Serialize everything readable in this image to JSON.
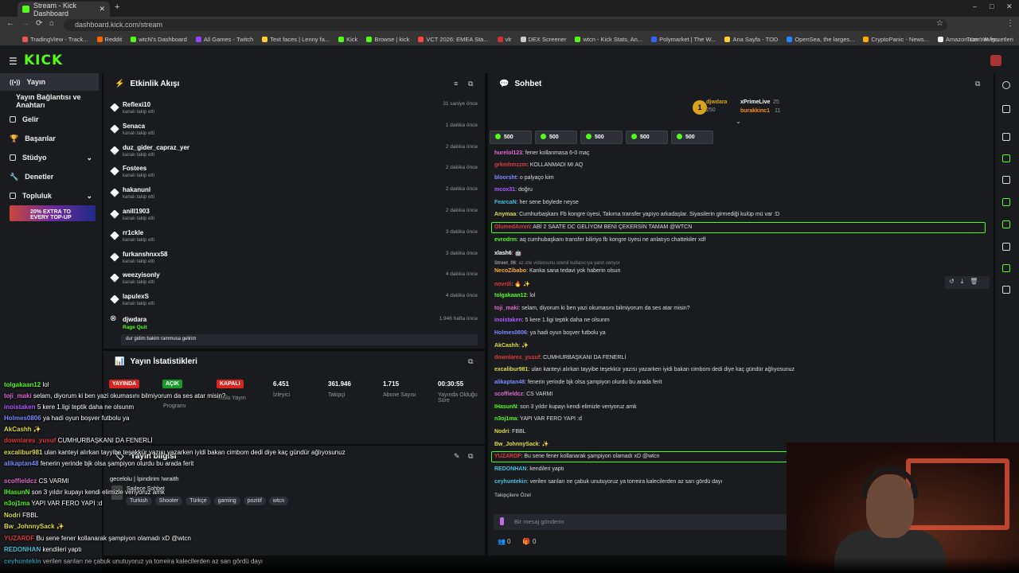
{
  "browser": {
    "tab_title": "Stream - Kick Dashboard",
    "url": "dashboard.kick.com/stream",
    "bookmarks": [
      "TradingView - Track...",
      "Reddit",
      "wtcN's Dashboard",
      "All Games - Twitch",
      "Text faces | Lenny fa...",
      "Kick",
      "Browse | kick",
      "VCT 2026: EMEA Sta...",
      "vlr",
      "DEX Screener",
      "wtcn - Kick Stats, An...",
      "Polymarket | The W...",
      "Ana Sayfa - TOD",
      "OpenSea, the larges...",
      "CryptoPanic - News...",
      "Amazon.com: AVer..."
    ],
    "all_bookmarks": "Tüm Yer İşaretleri"
  },
  "logo": "KICK",
  "sidebar": {
    "items": [
      {
        "label": "Yayın"
      },
      {
        "label": "Yayın Bağlantısı ve Anahtarı"
      },
      {
        "label": "Gelir"
      },
      {
        "label": "Başarılar"
      },
      {
        "label": "Stüdyo"
      },
      {
        "label": "Denetler"
      },
      {
        "label": "Topluluk"
      }
    ],
    "banner": "20% EXTRA TO EVERY TOP-UP"
  },
  "activity": {
    "title": "Etkinlik Akışı",
    "rows": [
      {
        "name": "Reflexi10",
        "sub": "kanalı takip etti",
        "time": "31 saniye önce"
      },
      {
        "name": "Senaca",
        "sub": "kanalı takip etti",
        "time": "1 dakika önce"
      },
      {
        "name": "duz_gider_capraz_yer",
        "sub": "kanalı takip etti",
        "time": "2 dakika önce"
      },
      {
        "name": "Fostees",
        "sub": "kanalı takip etti",
        "time": "2 dakika önce"
      },
      {
        "name": "hakanunl",
        "sub": "kanalı takip etti",
        "time": "2 dakika önce"
      },
      {
        "name": "anill1903",
        "sub": "kanalı takip etti",
        "time": "2 dakika önce"
      },
      {
        "name": "rr1ckle",
        "sub": "kanalı takip etti",
        "time": "3 dakika önce"
      },
      {
        "name": "furkanshnxx58",
        "sub": "kanalı takip etti",
        "time": "3 dakika önce"
      },
      {
        "name": "weezyisonly",
        "sub": "kanalı takip etti",
        "time": "4 dakika önce"
      },
      {
        "name": "lapulexS",
        "sub": "kanalı takip etti",
        "time": "4 dakika önce"
      }
    ],
    "ban": {
      "name": "djwdara",
      "reason": "Rage Quit",
      "time": "1.946 hafta önce",
      "note": "dur gidim bakim rammusa gelirim"
    }
  },
  "stats": {
    "title": "Yayın İstatistikleri",
    "badges": [
      {
        "label": "YAYINDA",
        "color": "#d6261f"
      },
      {
        "label": "AÇIK",
        "color": "#1a9a2a"
      },
      {
        "label": "KAPALI",
        "color": "#d6261f"
      }
    ],
    "badge_subs": [
      "Programı",
      "Kullu Yayın"
    ],
    "numbers": [
      {
        "value": "6.451",
        "label": "İzleyici"
      },
      {
        "value": "361.946",
        "label": "Takipçi"
      },
      {
        "value": "1.715",
        "label": "Abone Sayısı"
      },
      {
        "value": "00:30:55",
        "label": "Yayında Olduğu Süre"
      }
    ]
  },
  "info": {
    "title": "Yayın bilgisi",
    "stream_title": "gecelolu | İpindirim !wraith",
    "category": "Sadece Sohbet",
    "tags": [
      "Turkish",
      "Shooter",
      "Türkçe",
      "gaming",
      "pozitif",
      "wtcn"
    ]
  },
  "chat": {
    "title": "Sohbet",
    "leaders": [
      {
        "name": "djwdara",
        "amount": "250"
      },
      {
        "name": "xPrimeLive",
        "amount": "25"
      },
      {
        "name": "burakkinc1",
        "amount": "11"
      }
    ],
    "gifts": [
      "500",
      "500",
      "500",
      "500",
      "500"
    ],
    "messages": [
      {
        "user": "hurelol123",
        "color": "#e06ad0",
        "text": "fener kollanmasa 6-0 maç"
      },
      {
        "user": "grkmhmzzm",
        "color": "#e23a3a",
        "text": "KOLLANMADI MI AQ"
      },
      {
        "user": "bloorsht",
        "color": "#7a8cff",
        "text": "o palyaço kim"
      },
      {
        "user": "mcox31",
        "color": "#b05cff",
        "text": "doğru"
      },
      {
        "user": "FearcaN",
        "color": "#45c2e0",
        "text": "her sene böylede neyse"
      },
      {
        "user": "Anymaa",
        "color": "#dddd44",
        "text": "Cumhurbaşkanı Fb kongre üyesi, Takıma transfer yapıyo arkadaşlar. Siyasilerin girmediği kulüp mü var :D"
      },
      {
        "user": "OlumedArrxn",
        "color": "#e23a3a",
        "text": "ABİ 2 SAATE DC GELİYOM BENİ ÇEKERSİN TAMAM @WTCN"
      },
      {
        "user": "evrodrm",
        "color": "#53fc18",
        "text": "aq cumhubaşkanı transfer biliriyo fb kongre üyesi ne anlatıyo chattekiler xdf"
      },
      {
        "user": "xlash6",
        "color": "#ffffff",
        "text": "🤖"
      },
      {
        "user": "Street_06",
        "color": "#999999",
        "text": "az izle videosunu istenil kullanıcıya yanıt veriyor"
      },
      {
        "user": "NecoZibabo",
        "color": "#ffaa33",
        "text": "Kanka sana tedavi yok haberin olsun"
      },
      {
        "user": "novrdi",
        "color": "#e23a3a",
        "text": "🔥 ✨"
      },
      {
        "user": "tolgakaan12",
        "color": "#53fc18",
        "text": "lol"
      },
      {
        "user": "toji_maki",
        "color": "#e06ad0",
        "text": "selam, diyorum ki ben yazi okumasını bilmiyorum da ses atar misin?"
      },
      {
        "user": "inoistaken",
        "color": "#b05cff",
        "text": "5 kere 1.ligi teptik daha ne olsunm"
      },
      {
        "user": "Holmes0806",
        "color": "#7a8cff",
        "text": "ya hadi oyun boşver futbolu ya"
      },
      {
        "user": "AkCashh",
        "color": "#dddd44",
        "text": "✨"
      },
      {
        "user": "downlares_yusuf",
        "color": "#e23a3a",
        "text": "CUMHURBAŞKANI DA FENERLİ"
      },
      {
        "user": "excalibur981",
        "color": "#dddd44",
        "text": "ulan kanteyi alırkan tayyibe teşekkür yazısı yazarken iyidi bakan cimbom dedi diye kaç gündür ağlıyosunuz"
      },
      {
        "user": "alikaptan48",
        "color": "#7a8cff",
        "text": "fenerin yerinde bjk olsa şampiyon olurdu bu arada ferit"
      },
      {
        "user": "scoffieldcz",
        "color": "#e06ad0",
        "text": "CS VARMI"
      },
      {
        "user": "IHasunN",
        "color": "#53fc18",
        "text": "son 3 yıldır kupayı kendi elimizle veriyoruz amk"
      },
      {
        "user": "n3oj1ma",
        "color": "#53fc18",
        "text": "YAPI VAR FERO YAPI :d"
      },
      {
        "user": "Nodri",
        "color": "#dddd44",
        "text": "FBBL"
      },
      {
        "user": "Bw_JohnnySack",
        "color": "#dddd44",
        "text": "✨"
      },
      {
        "user": "YUZARDF",
        "color": "#e23a3a",
        "text": "Bu sene fener kollanarak şampiyon olamadı xD @wtcn"
      },
      {
        "user": "REDONHAN",
        "color": "#45c2e0",
        "text": "kendileri yaptı"
      },
      {
        "user": "ceyhuntekin",
        "color": "#45c2e0",
        "text": "verilen sarıları ne çabuk unutuyoruz ya torreira kalecilerden az sarı gördü dayı"
      }
    ],
    "followers_only": "Takipçilere Özel",
    "input_placeholder": "Bir mesaj gönderin",
    "viewer_count": "0",
    "gift_count": "0"
  },
  "overlay": {
    "lines": [
      {
        "user": "tolgakaan12",
        "color": "#53fc18",
        "text": "lol"
      },
      {
        "user": "toji_maki",
        "color": "#e06ad0",
        "text": "selam, diyorum ki ben yazi okumasını bilmiyorum da ses atar misin?"
      },
      {
        "user": "inoistaken",
        "color": "#b05cff",
        "text": "5 kere 1.ligi teptik daha ne olsunm"
      },
      {
        "user": "Holmes0806",
        "color": "#7a8cff",
        "text": "ya hadi oyun boşver futbolu ya"
      },
      {
        "user": "AkCashh",
        "color": "#dddd44",
        "text": "✨"
      },
      {
        "user": "downlares_yusuf",
        "color": "#e23a3a",
        "text": "CUMHURBAŞKANI DA FENERLİ"
      },
      {
        "user": "excalibur981",
        "color": "#dddd44",
        "text": "ulan kanteyi alırkan tayyibe teşekkür yazısı yazarken iyidi bakan cimbom dedi diye kaç gündür ağlıyosunuz"
      },
      {
        "user": "alikaptan48",
        "color": "#7a8cff",
        "text": "fenerin yerinde bjk olsa şampiyon olurdu bu arada ferit"
      },
      {
        "user": "scoffieldcz",
        "color": "#e06ad0",
        "text": "CS VARMI"
      },
      {
        "user": "IHasunN",
        "color": "#53fc18",
        "text": "son 3 yıldır kupayı kendi elimizle veriyoruz amk"
      },
      {
        "user": "n3oj1ma",
        "color": "#53fc18",
        "text": "YAPI VAR FERO YAPI :d"
      },
      {
        "user": "Nodri",
        "color": "#dddd44",
        "text": "FBBL"
      },
      {
        "user": "Bw_JohnnySack",
        "color": "#dddd44",
        "text": "✨"
      },
      {
        "user": "YUZARDF",
        "color": "#e23a3a",
        "text": "Bu sene fener kollanarak şampiyon olamadı xD @wtcn"
      },
      {
        "user": "REDONHAN",
        "color": "#45c2e0",
        "text": "kendileri yaptı"
      },
      {
        "user": "ceyhuntekin",
        "color": "#45c2e0",
        "text": "verilen sarıları ne çabuk unutuyoruz ya torreira kalecilerden az sarı gördü dayı"
      }
    ]
  },
  "colors": {
    "accent": "#53fc18",
    "panel": "#191b1f",
    "bg": "#0b0e0f"
  }
}
